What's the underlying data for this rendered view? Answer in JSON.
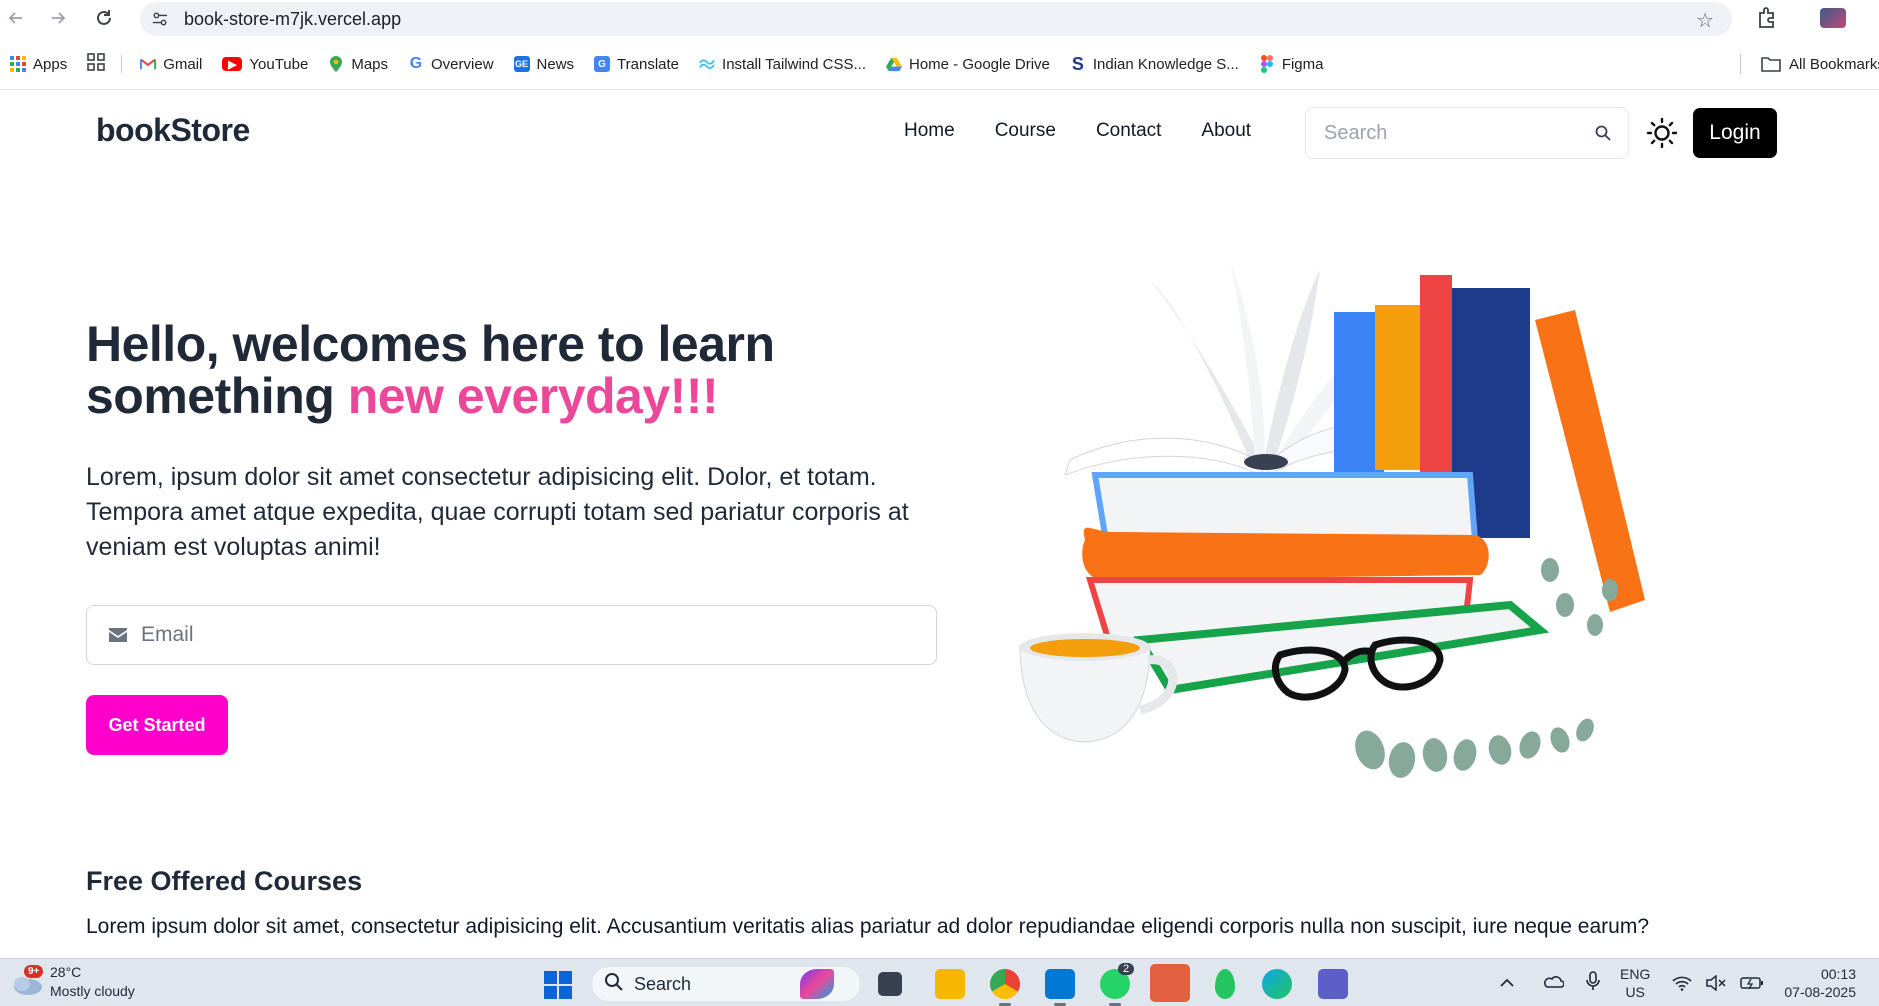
{
  "browser": {
    "url": "book-store-m7jk.vercel.app",
    "bookmarks": [
      {
        "label": "Apps",
        "icon": "apps-grid-icon",
        "color": "#4285f4"
      },
      {
        "label": "Gmail",
        "icon": "gmail-icon",
        "color": "#ea4335"
      },
      {
        "label": "YouTube",
        "icon": "youtube-icon",
        "color": "#ff0000"
      },
      {
        "label": "Maps",
        "icon": "maps-icon",
        "color": "#34a853"
      },
      {
        "label": "Overview",
        "icon": "google-icon",
        "color": "#4285f4"
      },
      {
        "label": "News",
        "icon": "news-icon",
        "color": "#1a73e8"
      },
      {
        "label": "Translate",
        "icon": "translate-icon",
        "color": "#4285f4"
      },
      {
        "label": "Install Tailwind CSS...",
        "icon": "tailwind-icon",
        "color": "#38bdf8"
      },
      {
        "label": "Home - Google Drive",
        "icon": "drive-icon",
        "color": "#fbbc04"
      },
      {
        "label": "Indian Knowledge S...",
        "icon": "s-logo-icon",
        "color": "#1e3a8a"
      },
      {
        "label": "Figma",
        "icon": "figma-icon",
        "color": "#f24e1e"
      }
    ],
    "all_bookmarks": "All Bookmarks"
  },
  "site": {
    "logo": "bookStore",
    "menu": [
      "Home",
      "Course",
      "Contact",
      "About"
    ],
    "search_placeholder": "Search",
    "login_label": "Login"
  },
  "hero": {
    "title_part1": "Hello, welcomes here to learn something ",
    "title_highlight": "new everyday!!!",
    "description": "Lorem, ipsum dolor sit amet consectetur adipisicing elit. Dolor, et totam. Tempora amet atque expedita, quae corrupti totam sed pariatur corporis at veniam est voluptas animi!",
    "email_placeholder": "Email",
    "cta_label": "Get Started"
  },
  "courses": {
    "title": "Free Offered Courses",
    "description": "Lorem ipsum dolor sit amet, consectetur adipisicing elit. Accusantium veritatis alias pariatur ad dolor repudiandae eligendi corporis nulla non suscipit, iure neque earum?"
  },
  "taskbar": {
    "weather_badge": "9+",
    "temperature": "28°C",
    "weather": "Mostly cloudy",
    "search_label": "Search",
    "whatsapp_badge": "2",
    "lang_top": "ENG",
    "lang_bottom": "US",
    "time": "00:13",
    "date": "07-08-2025"
  },
  "colors": {
    "accent_pink": "#ec4899",
    "cta_magenta": "#ff00cc",
    "login_bg": "#000000"
  }
}
